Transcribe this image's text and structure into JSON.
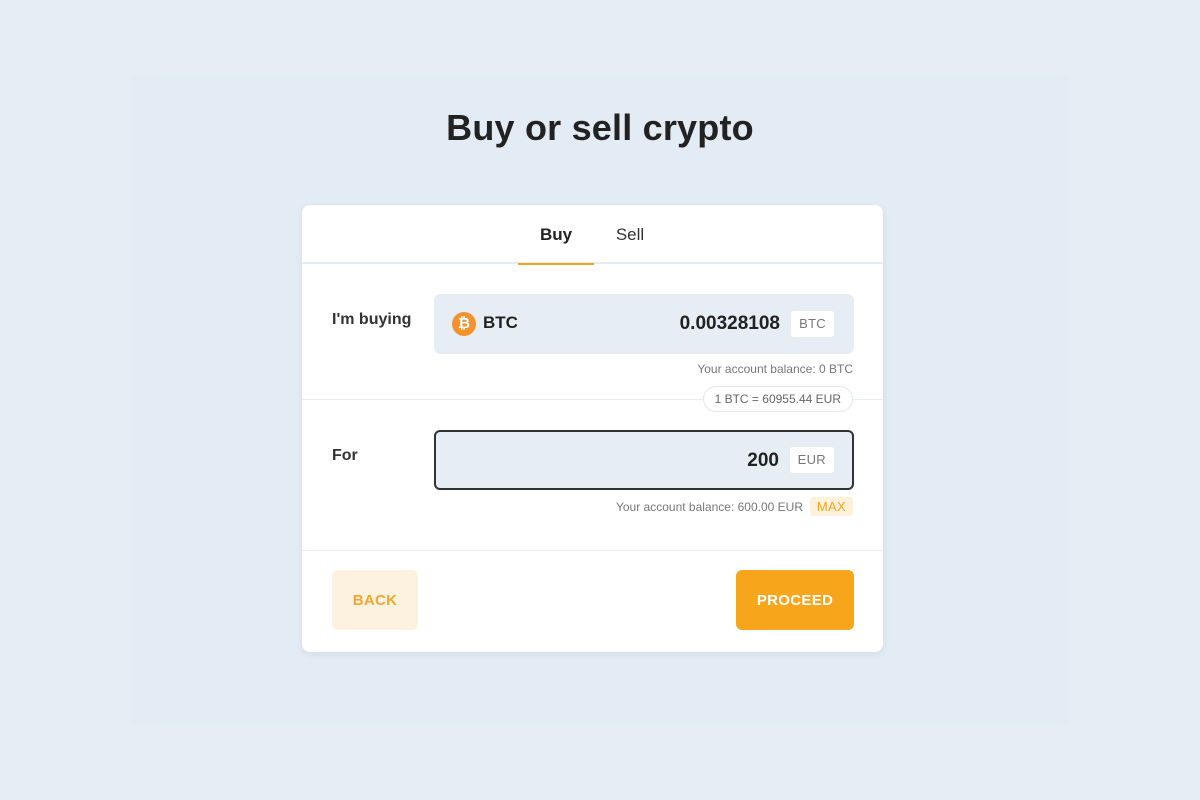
{
  "page": {
    "title": "Buy or sell crypto"
  },
  "tabs": [
    {
      "label": "Buy",
      "active": true
    },
    {
      "label": "Sell",
      "active": false
    }
  ],
  "buying": {
    "label": "I'm buying",
    "coin_icon": "bitcoin-icon",
    "coin_glyph": "₿",
    "coin_name": "BTC",
    "amount": "0.00328108",
    "unit": "BTC",
    "balance": "Your account balance: 0 BTC"
  },
  "rate": "1 BTC = 60955.44 EUR",
  "paying": {
    "label": "For",
    "amount": "200",
    "unit": "EUR",
    "balance": "Your account balance: 600.00 EUR",
    "max_label": "MAX"
  },
  "actions": {
    "back": "BACK",
    "proceed": "PROCEED"
  },
  "colors": {
    "accent": "#f7a61c",
    "accent_soft": "#fdf1df",
    "background": "#e6edf5",
    "bitcoin": "#f3922c"
  }
}
